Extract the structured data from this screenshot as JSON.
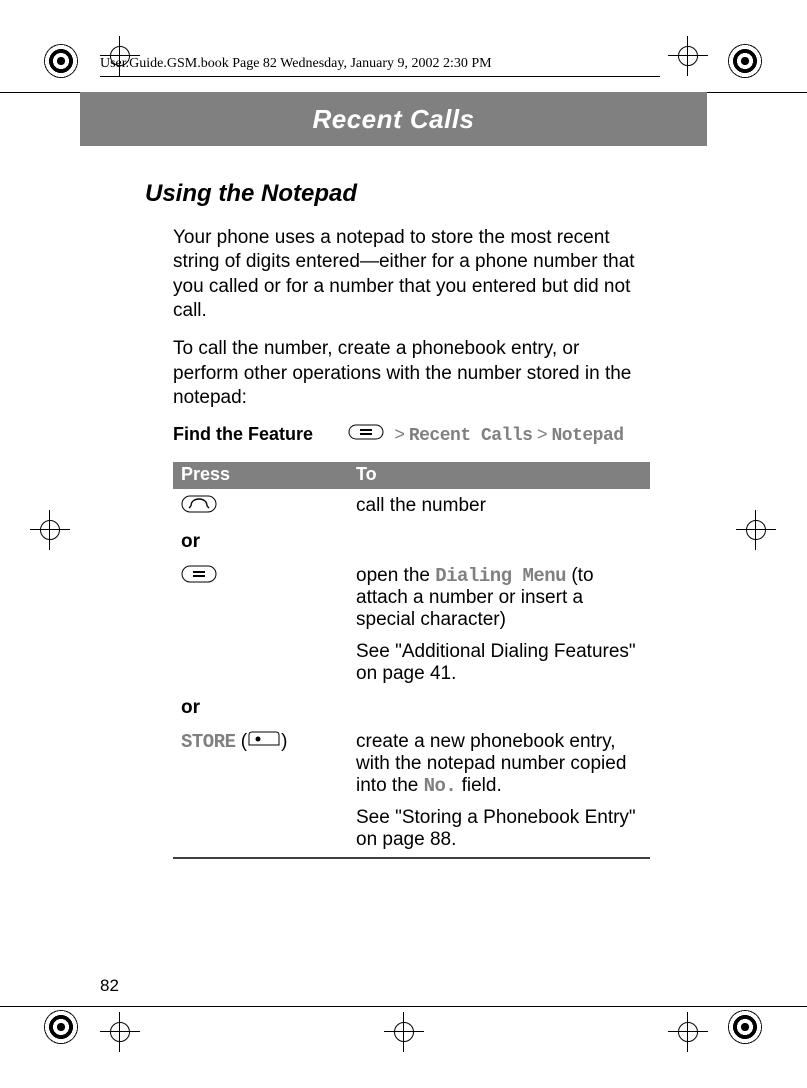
{
  "running_header": "User.Guide.GSM.book  Page 82  Wednesday, January 9, 2002  2:30 PM",
  "chapter_title": "Recent Calls",
  "section_title": "Using the Notepad",
  "paragraphs": [
    "Your phone uses a notepad to store the most recent string of digits entered—either for a phone number that you called or for a number that you entered but did not call.",
    "To call the number, create a phonebook entry, or perform other operations with the number stored in the notepad:"
  ],
  "find_the_feature_label": "Find the Feature",
  "nav_path": {
    "step1": "Recent Calls",
    "step2": "Notepad"
  },
  "table": {
    "head_press": "Press",
    "head_to": "To",
    "rows": {
      "r0_to": "call the number",
      "or1": "or",
      "r1_to_a": "open the ",
      "r1_to_menu": "Dialing Menu",
      "r1_to_b": " (to attach a number or insert a special character)",
      "r1_see": "See \"Additional Dialing Features\" on page 41.",
      "or2": "or",
      "r2_store": "STORE",
      "r2_to_a": "create a new phonebook entry, with the notepad number copied into the ",
      "r2_no": "No.",
      "r2_to_b": " field.",
      "r2_see": "See \"Storing a Phonebook Entry\" on page 88."
    }
  },
  "page_number": "82"
}
